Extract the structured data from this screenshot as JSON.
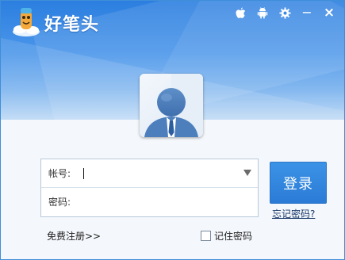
{
  "app": {
    "title": "好笔头"
  },
  "topbar": {
    "icons": [
      "apple-icon",
      "android-icon",
      "settings-gear-icon",
      "minimize-icon",
      "close-icon"
    ],
    "minimize_glyph": "−",
    "close_glyph": "×"
  },
  "form": {
    "account_label": "帐号:",
    "account_value": "",
    "password_label": "密码:",
    "password_value": ""
  },
  "actions": {
    "login_label": "登录",
    "forgot_label": "忘记密码?",
    "register_label": "免费注册>>",
    "remember_label": "记住密码",
    "remember_checked": false
  },
  "colors": {
    "header_top": "#2c7fe0",
    "login_button": "#2b7bd6",
    "window_border": "#3f8ed8"
  }
}
